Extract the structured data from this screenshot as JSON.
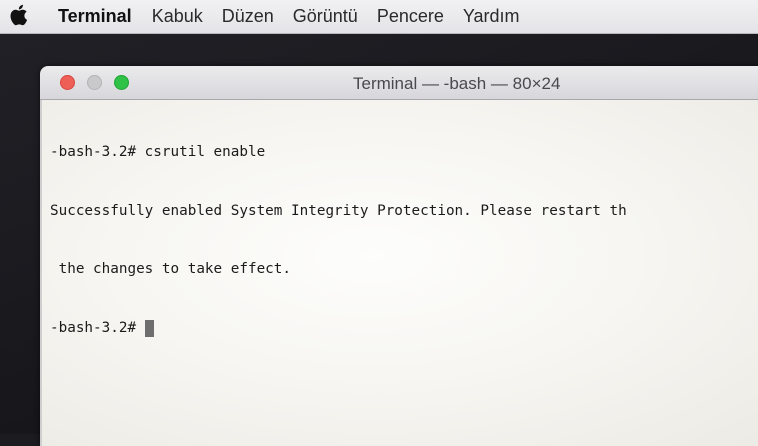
{
  "menubar": {
    "apple_icon": "apple-logo-icon",
    "app_name": "Terminal",
    "items": [
      "Kabuk",
      "Düzen",
      "Görüntü",
      "Pencere",
      "Yardım"
    ]
  },
  "window": {
    "title": "Terminal — -bash — 80×24",
    "traffic_lights": {
      "close_color": "#ee5f57",
      "minimize_color": "#c9c9cc",
      "zoom_color": "#2fc246"
    }
  },
  "terminal": {
    "lines": [
      "-bash-3.2# csrutil enable",
      "Successfully enabled System Integrity Protection. Please restart th",
      " the changes to take effect."
    ],
    "prompt": "-bash-3.2#"
  }
}
